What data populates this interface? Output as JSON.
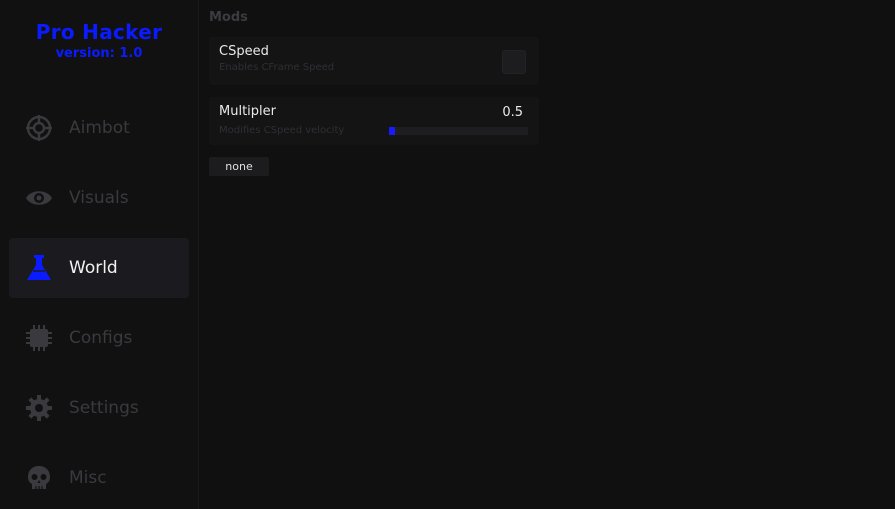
{
  "brand": {
    "title": "Pro Hacker",
    "version": "version: 1.0",
    "color": "#0b1bff"
  },
  "sidebar": {
    "accent": "#0b1bff",
    "items": [
      {
        "label": "Aimbot",
        "icon": "crosshair-icon",
        "active": false
      },
      {
        "label": "Visuals",
        "icon": "eye-icon",
        "active": false
      },
      {
        "label": "World",
        "icon": "flask-icon",
        "active": true
      },
      {
        "label": "Configs",
        "icon": "chip-icon",
        "active": false
      },
      {
        "label": "Settings",
        "icon": "gear-icon",
        "active": false
      },
      {
        "label": "Misc",
        "icon": "skull-icon",
        "active": false
      }
    ]
  },
  "main": {
    "section_title": "Mods",
    "toggle": {
      "title": "CSpeed",
      "description": "Enables CFrame Speed",
      "checked": false
    },
    "slider": {
      "title": "Multipler",
      "description": "Modifies CSpeed velocity",
      "value": "0.5",
      "fraction": 0.03
    },
    "dropdown": {
      "value": "none"
    }
  }
}
